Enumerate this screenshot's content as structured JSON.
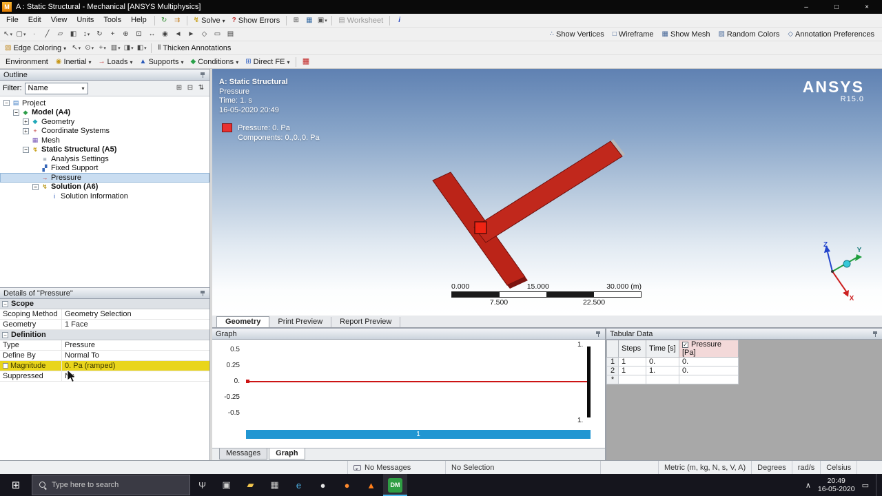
{
  "colors": {
    "viewport_top": "#5f81b2",
    "geometry_red": "#c1281c",
    "highlight_yellow": "#e9d51c",
    "step_bar_blue": "#2196d2",
    "legend_red": "#e83030",
    "pressure_header_red": "#a01010"
  },
  "title_bar": {
    "app_badge": "M",
    "title": "A : Static Structural - Mechanical [ANSYS Multiphysics]",
    "controls": [
      {
        "name": "minimize-button",
        "glyph": "–"
      },
      {
        "name": "maximize-button",
        "glyph": "□"
      },
      {
        "name": "close-button",
        "glyph": "×"
      }
    ]
  },
  "menus": [
    "File",
    "Edit",
    "View",
    "Units",
    "Tools",
    "Help"
  ],
  "toolbar_main": {
    "quick_icons": [
      {
        "name": "refresh-icon",
        "glyph": "↻",
        "color": "#2a8a2a"
      },
      {
        "name": "update-project-icon",
        "glyph": "⇉",
        "color": "#c07818"
      }
    ],
    "solve_icon": "↯",
    "solve_label": "Solve",
    "show_errors_icon": "?",
    "show_errors_label": "Show Errors",
    "mid_icons": [
      {
        "name": "grid-icon",
        "glyph": "⊞",
        "color": "#555555"
      },
      {
        "name": "chart-icon",
        "glyph": "▦",
        "color": "#3a6ea5"
      },
      {
        "name": "snapshot-icon",
        "glyph": "▣",
        "color": "#555555",
        "dd": "dd"
      }
    ],
    "worksheet_icon": "▤",
    "worksheet_label": "Worksheet",
    "selection_info_icon": "i",
    "right_buttons": [
      {
        "name": "show-vertices-button",
        "glyph": "∴",
        "label": "Show Vertices"
      },
      {
        "name": "wireframe-button",
        "glyph": "□",
        "label": "Wireframe"
      },
      {
        "name": "show-mesh-button",
        "glyph": "▦",
        "label": "Show Mesh"
      },
      {
        "name": "random-colors-button",
        "glyph": "▨",
        "label": "Random Colors"
      },
      {
        "name": "annotation-preferences-button",
        "glyph": "◇",
        "label": "Annotation Preferences"
      }
    ]
  },
  "toolbar_nav": {
    "icons": [
      {
        "name": "label-pointer-icon",
        "glyph": "↖",
        "dd": "dd"
      },
      {
        "name": "select-mode-icon",
        "glyph": "▢",
        "dd": "dd"
      },
      {
        "name": "vertex-filter-icon",
        "glyph": "∙"
      },
      {
        "name": "edge-filter-icon",
        "glyph": "╱"
      },
      {
        "name": "face-filter-icon",
        "glyph": "▱"
      },
      {
        "name": "body-filter-icon",
        "glyph": "◧"
      },
      {
        "name": "extend-selection-icon",
        "glyph": "↕",
        "dd": "dd"
      },
      {
        "name": "rotate-icon",
        "glyph": "↻"
      },
      {
        "name": "pan-icon",
        "glyph": "+"
      },
      {
        "name": "zoom-icon",
        "glyph": "⊕"
      },
      {
        "name": "box-zoom-icon",
        "glyph": "⊡"
      },
      {
        "name": "fit-icon",
        "glyph": "↔"
      },
      {
        "name": "magnifier-icon",
        "glyph": "◉"
      },
      {
        "name": "previous-view-icon",
        "glyph": "◄"
      },
      {
        "name": "next-view-icon",
        "glyph": "►"
      },
      {
        "name": "iso-view-icon",
        "glyph": "◇"
      },
      {
        "name": "look-at-icon",
        "glyph": "▭"
      },
      {
        "name": "manage-views-icon",
        "glyph": "▤"
      }
    ]
  },
  "toolbar_edge": {
    "edge_icon": "▧",
    "edge_coloring_label": "Edge Coloring",
    "icons": [
      {
        "name": "probe-icon",
        "glyph": "↖",
        "dd": "dd"
      },
      {
        "name": "scoping-icon",
        "glyph": "⊙",
        "dd": "dd"
      },
      {
        "name": "coordinate-icon",
        "glyph": "+",
        "dd": "dd"
      },
      {
        "name": "clipboard-icon",
        "glyph": "▥",
        "dd": "dd"
      },
      {
        "name": "section-plane-icon",
        "glyph": "◨",
        "dd": "dd"
      },
      {
        "name": "viewports-icon",
        "glyph": "◧",
        "dd": "dd"
      }
    ],
    "thicken_icon": "‖",
    "thicken_label": "Thicken Annotations"
  },
  "context_bar": {
    "environment_label": "Environment",
    "groups": [
      {
        "name": "inertial-menu",
        "glyph": "◉",
        "color": "#c89818",
        "label": "Inertial"
      },
      {
        "name": "loads-menu",
        "glyph": "→",
        "color": "#c02020",
        "label": "Loads"
      },
      {
        "name": "supports-menu",
        "glyph": "▲",
        "color": "#2858b8",
        "label": "Supports"
      },
      {
        "name": "conditions-menu",
        "glyph": "◆",
        "color": "#28a048",
        "label": "Conditions"
      },
      {
        "name": "direct-fe-menu",
        "glyph": "⊞",
        "color": "#3060c0",
        "label": "Direct FE"
      }
    ],
    "end_icon": "▦"
  },
  "outline": {
    "caption": "Outline",
    "filter_label": "Filter:",
    "filter_value": "Name",
    "filter_icons": [
      {
        "name": "expand-all-icon",
        "glyph": "⊞"
      },
      {
        "name": "collapse-all-icon",
        "glyph": "⊟"
      },
      {
        "name": "sort-icon",
        "glyph": "⇅"
      }
    ],
    "tree": [
      {
        "name": "tree-item-project",
        "label": "Project",
        "icon": "▤",
        "color": "#3a78c2",
        "cls": "lvl0",
        "exp": "−"
      },
      {
        "name": "tree-item-model-a4",
        "label": "Model (A4)",
        "icon": "◆",
        "color": "#2e9e4a",
        "cls": "lvl1 bold",
        "exp": "−"
      },
      {
        "name": "tree-item-geometry",
        "label": "Geometry",
        "icon": "◆",
        "color": "#20a8b8",
        "cls": "lvl2",
        "exp": "+"
      },
      {
        "name": "tree-item-coordinate-systems",
        "label": "Coordinate Systems",
        "icon": "+",
        "color": "#c03838",
        "cls": "lvl2",
        "exp": "+"
      },
      {
        "name": "tree-item-mesh",
        "label": "Mesh",
        "icon": "▦",
        "color": "#7858b8",
        "cls": "lvl2",
        "exp": ""
      },
      {
        "name": "tree-item-static-structural-a5",
        "label": "Static Structural (A5)",
        "icon": "↯",
        "color": "#c8a018",
        "cls": "lvl2 bold",
        "exp": "−"
      },
      {
        "name": "tree-item-analysis-settings",
        "label": "Analysis Settings",
        "icon": "≡",
        "color": "#687888",
        "cls": "lvl3",
        "exp": ""
      },
      {
        "name": "tree-item-fixed-support",
        "label": "Fixed Support",
        "icon": "▞",
        "color": "#3868b8",
        "cls": "lvl3",
        "exp": ""
      },
      {
        "name": "tree-item-pressure",
        "label": "Pressure",
        "icon": "→",
        "color": "#c03030",
        "cls": "lvl3 selected",
        "exp": ""
      },
      {
        "name": "tree-item-solution-a6",
        "label": "Solution (A6)",
        "icon": "↯",
        "color": "#b89818",
        "cls": "lvl3 bold",
        "exp": "−"
      },
      {
        "name": "tree-item-solution-information",
        "label": "Solution Information",
        "icon": "i",
        "color": "#2858b8",
        "cls": "lvl4",
        "exp": ""
      }
    ]
  },
  "details": {
    "caption": "Details of \"Pressure\"",
    "sections": {
      "scope": "Scope",
      "definition": "Definition"
    },
    "rows": {
      "scoping_method_label": "Scoping Method",
      "scoping_method_value": "Geometry Selection",
      "geometry_label": "Geometry",
      "geometry_value": "1 Face",
      "type_label": "Type",
      "type_value": "Pressure",
      "define_by_label": "Define By",
      "define_by_value": "Normal To",
      "magnitude_label": "Magnitude",
      "magnitude_value": "0. Pa (ramped)",
      "suppressed_label": "Suppressed",
      "suppressed_value": "No"
    }
  },
  "viewport": {
    "annotations": {
      "title": "A: Static Structural",
      "object": "Pressure",
      "time": "Time: 1. s",
      "datetime": "16-05-2020 20:49"
    },
    "legend": {
      "item": "Pressure: 0. Pa",
      "components": "Components: 0.,0.,0. Pa"
    },
    "brand_name": "ANSYS",
    "brand_version": "R15.0",
    "ruler": {
      "top_labels": [
        "0.000",
        "15.000",
        "30.000 (m)"
      ],
      "bottom_labels": [
        "7.500",
        "22.500"
      ]
    },
    "triad": {
      "x": "X",
      "y": "Y",
      "z": "Z"
    },
    "tabs": [
      {
        "label": "Geometry",
        "cls": "active"
      },
      {
        "label": "Print Preview"
      },
      {
        "label": "Report Preview"
      }
    ]
  },
  "graph": {
    "caption": "Graph",
    "y_ticks": [
      "0.5",
      "0.25",
      "0.",
      "-0.25",
      "-0.5"
    ],
    "marker_top_label": "1.",
    "marker_bottom_label": "1.",
    "step_bar_label": "1",
    "tabs": [
      {
        "label": "Messages"
      },
      {
        "label": "Graph",
        "cls": "active"
      }
    ]
  },
  "tabular": {
    "caption": "Tabular Data",
    "check_glyph": "✓",
    "columns": {
      "steps": "Steps",
      "time": "Time [s]",
      "pressure": "Pressure [Pa]"
    },
    "rows": [
      {
        "n": "1",
        "steps": "1",
        "time": "0.",
        "pressure": "0."
      },
      {
        "n": "2",
        "steps": "1",
        "time": "1.",
        "pressure": "0."
      },
      {
        "n": "*",
        "steps": "",
        "time": "",
        "pressure": ""
      }
    ]
  },
  "status_bar": {
    "messages": "No Messages",
    "selection": "No Selection",
    "units": [
      "Metric (m, kg, N, s, V, A)",
      "Degrees",
      "rad/s",
      "Celsius"
    ]
  },
  "taskbar": {
    "start_glyph": "⊞",
    "search_placeholder": "Type here to search",
    "icons": [
      {
        "name": "speech-icon",
        "glyph": "Ψ",
        "color": "#d0d0d0"
      },
      {
        "name": "task-view-icon",
        "glyph": "▣",
        "color": "#d0d0d0"
      },
      {
        "name": "file-explorer-icon",
        "glyph": "▰",
        "color": "#f1c54d"
      },
      {
        "name": "store-icon",
        "glyph": "▦",
        "color": "#c8c8c8"
      },
      {
        "name": "edge-icon",
        "glyph": "e",
        "color": "#4fb3e8"
      },
      {
        "name": "browser-icon",
        "glyph": "●",
        "color": "#e4e4e4"
      },
      {
        "name": "firefox-icon",
        "glyph": "●",
        "color": "#ff8a2e"
      },
      {
        "name": "vlc-icon",
        "glyph": "▲",
        "color": "#ff7f1a"
      }
    ],
    "dm_label": "DM",
    "tray_up_glyph": "∧",
    "time": "20:49",
    "date": "16-05-2020",
    "notification_glyph": "▭"
  }
}
